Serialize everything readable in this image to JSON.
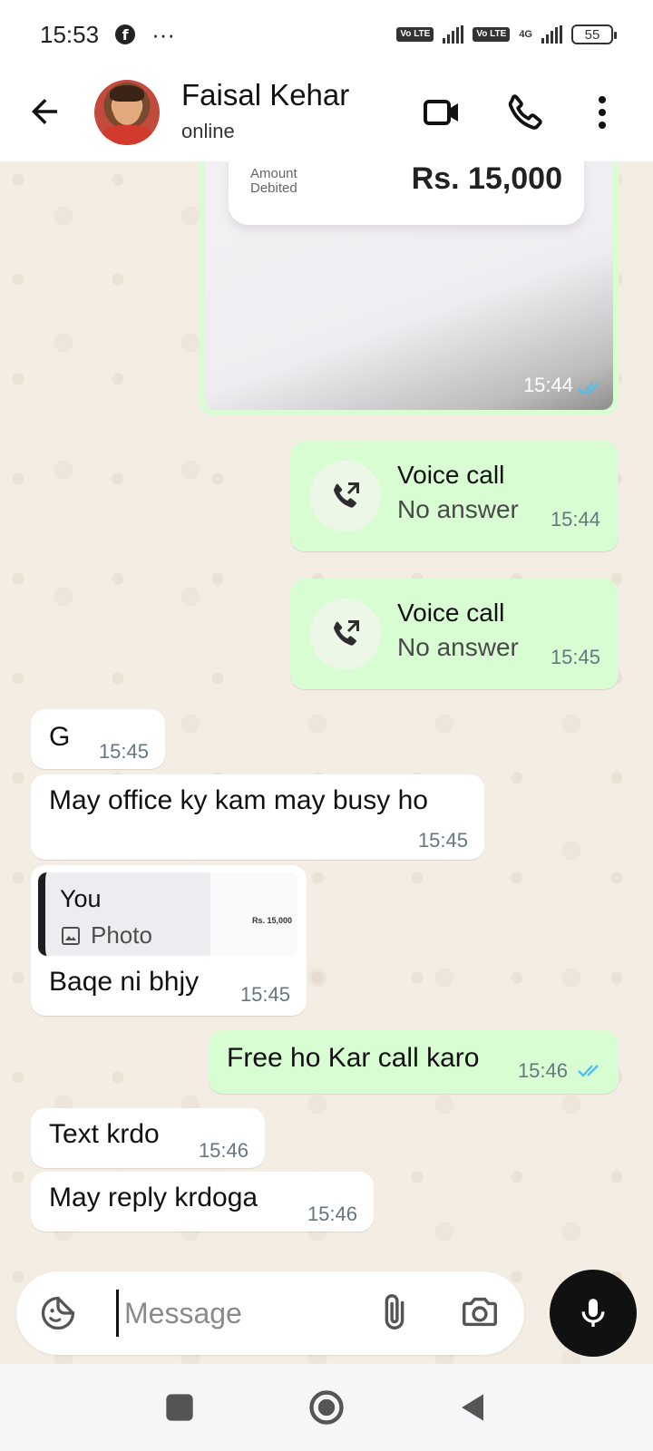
{
  "status_bar": {
    "time": "15:53",
    "dots": "···",
    "volte1": "Vo LTE",
    "volte2": "Vo LTE",
    "network": "4G",
    "battery": "55"
  },
  "header": {
    "contact_name": "Faisal Kehar",
    "contact_status": "online"
  },
  "messages": {
    "image_msg": {
      "amount_label": "Amount Debited",
      "amount_value": "Rs. 15,000",
      "time": "15:44"
    },
    "call1": {
      "title": "Voice call",
      "subtitle": "No answer",
      "time": "15:44"
    },
    "call2": {
      "title": "Voice call",
      "subtitle": "No answer",
      "time": "15:45"
    },
    "msg_g": {
      "text": "G",
      "time": "15:45"
    },
    "msg_busy": {
      "text": "May office ky kam may busy ho",
      "time": "15:45"
    },
    "msg_reply": {
      "quote_author": "You",
      "quote_type": "Photo",
      "quote_thumb_amount": "Rs. 15,000",
      "text": "Baqe ni bhjy",
      "time": "15:45"
    },
    "msg_free": {
      "text": "Free ho Kar call karo",
      "time": "15:46"
    },
    "msg_text": {
      "text": "Text krdo",
      "time": "15:46"
    },
    "msg_reply2": {
      "text": "May reply krdoga",
      "time": "15:46"
    }
  },
  "composer": {
    "placeholder": "Message"
  },
  "colors": {
    "outgoing_bubble": "#d9fdd3",
    "incoming_bubble": "#ffffff",
    "read_ticks": "#53bdeb",
    "chat_background": "#f3ede4"
  }
}
